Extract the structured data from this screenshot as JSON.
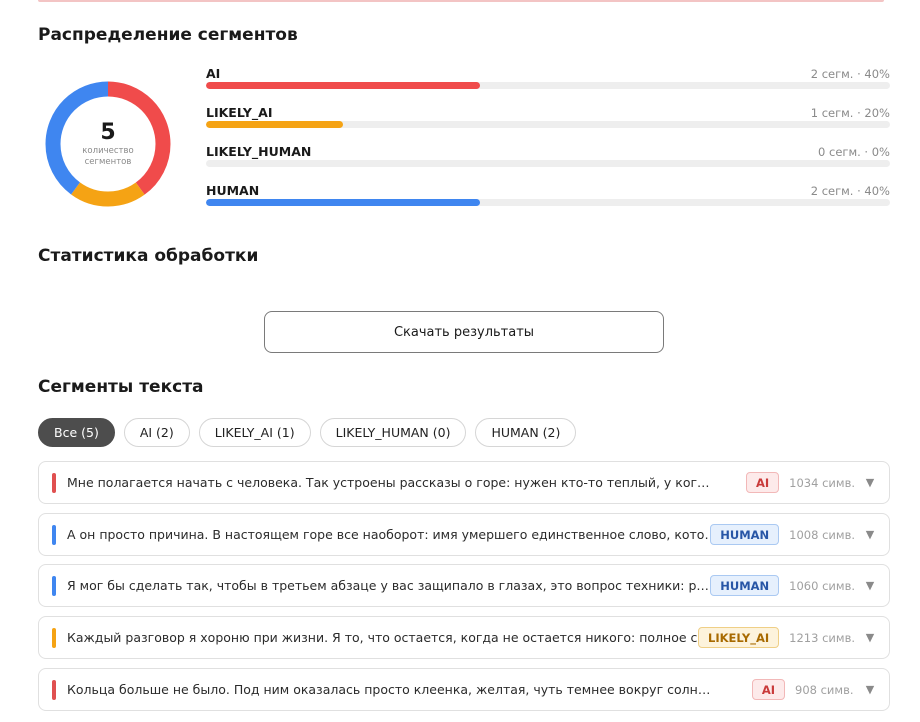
{
  "distribution": {
    "title": "Распределение сегментов",
    "total": "5",
    "total_caption": "количество сегментов",
    "rows": [
      {
        "label": "AI",
        "meta": "2 сегм. · 40%",
        "fraction": 0.4,
        "color": "#f04b4b"
      },
      {
        "label": "LIKELY_AI",
        "meta": "1 сегм. · 20%",
        "fraction": 0.2,
        "color": "#f5a314"
      },
      {
        "label": "LIKELY_HUMAN",
        "meta": "0 сегм. · 0%",
        "fraction": 0.0,
        "color": "#9e9e9e"
      },
      {
        "label": "HUMAN",
        "meta": "2 сегм. · 40%",
        "fraction": 0.4,
        "color": "#3f86f0"
      }
    ]
  },
  "stats": {
    "title": "Статистика обработки",
    "download_label": "Скачать результаты"
  },
  "segments": {
    "title": "Сегменты текста",
    "filters": [
      "Все (5)",
      "AI (2)",
      "LIKELY_AI (1)",
      "LIKELY_HUMAN (0)",
      "HUMAN (2)"
    ],
    "items": [
      {
        "text": "Мне полагается начать с человека. Так устроены рассказы о горе: нужен кто-то теплый, у кого можно чт...",
        "badge": "AI",
        "kind": "ai",
        "chars": "1034 симв.",
        "color": "#e05050"
      },
      {
        "text": "А он просто причина. В настоящем горе все наоборот: имя умершего единственное слово, которое ост...",
        "badge": "HUMAN",
        "kind": "human",
        "chars": "1008 симв.",
        "color": "#3f86f0"
      },
      {
        "text": "Я мог бы сделать так, чтобы в третьем абзаце у вас защипало в глазах, это вопрос техники: ритм, длин...",
        "badge": "HUMAN",
        "kind": "human",
        "chars": "1060 симв.",
        "color": "#3f86f0"
      },
      {
        "text": "Каждый разговор я хороню при жизни. Я то, что остается, когда не остается никого: полное собрание...",
        "badge": "LIKELY_AI",
        "kind": "likely_ai",
        "chars": "1213 симв.",
        "color": "#f5a314"
      },
      {
        "text": "Кольца больше не было. Под ним оказалась просто клеенка, желтая, чуть темнее вокруг солнце за месяц ...",
        "badge": "AI",
        "kind": "ai",
        "chars": "908 симв.",
        "color": "#e05050"
      }
    ]
  }
}
